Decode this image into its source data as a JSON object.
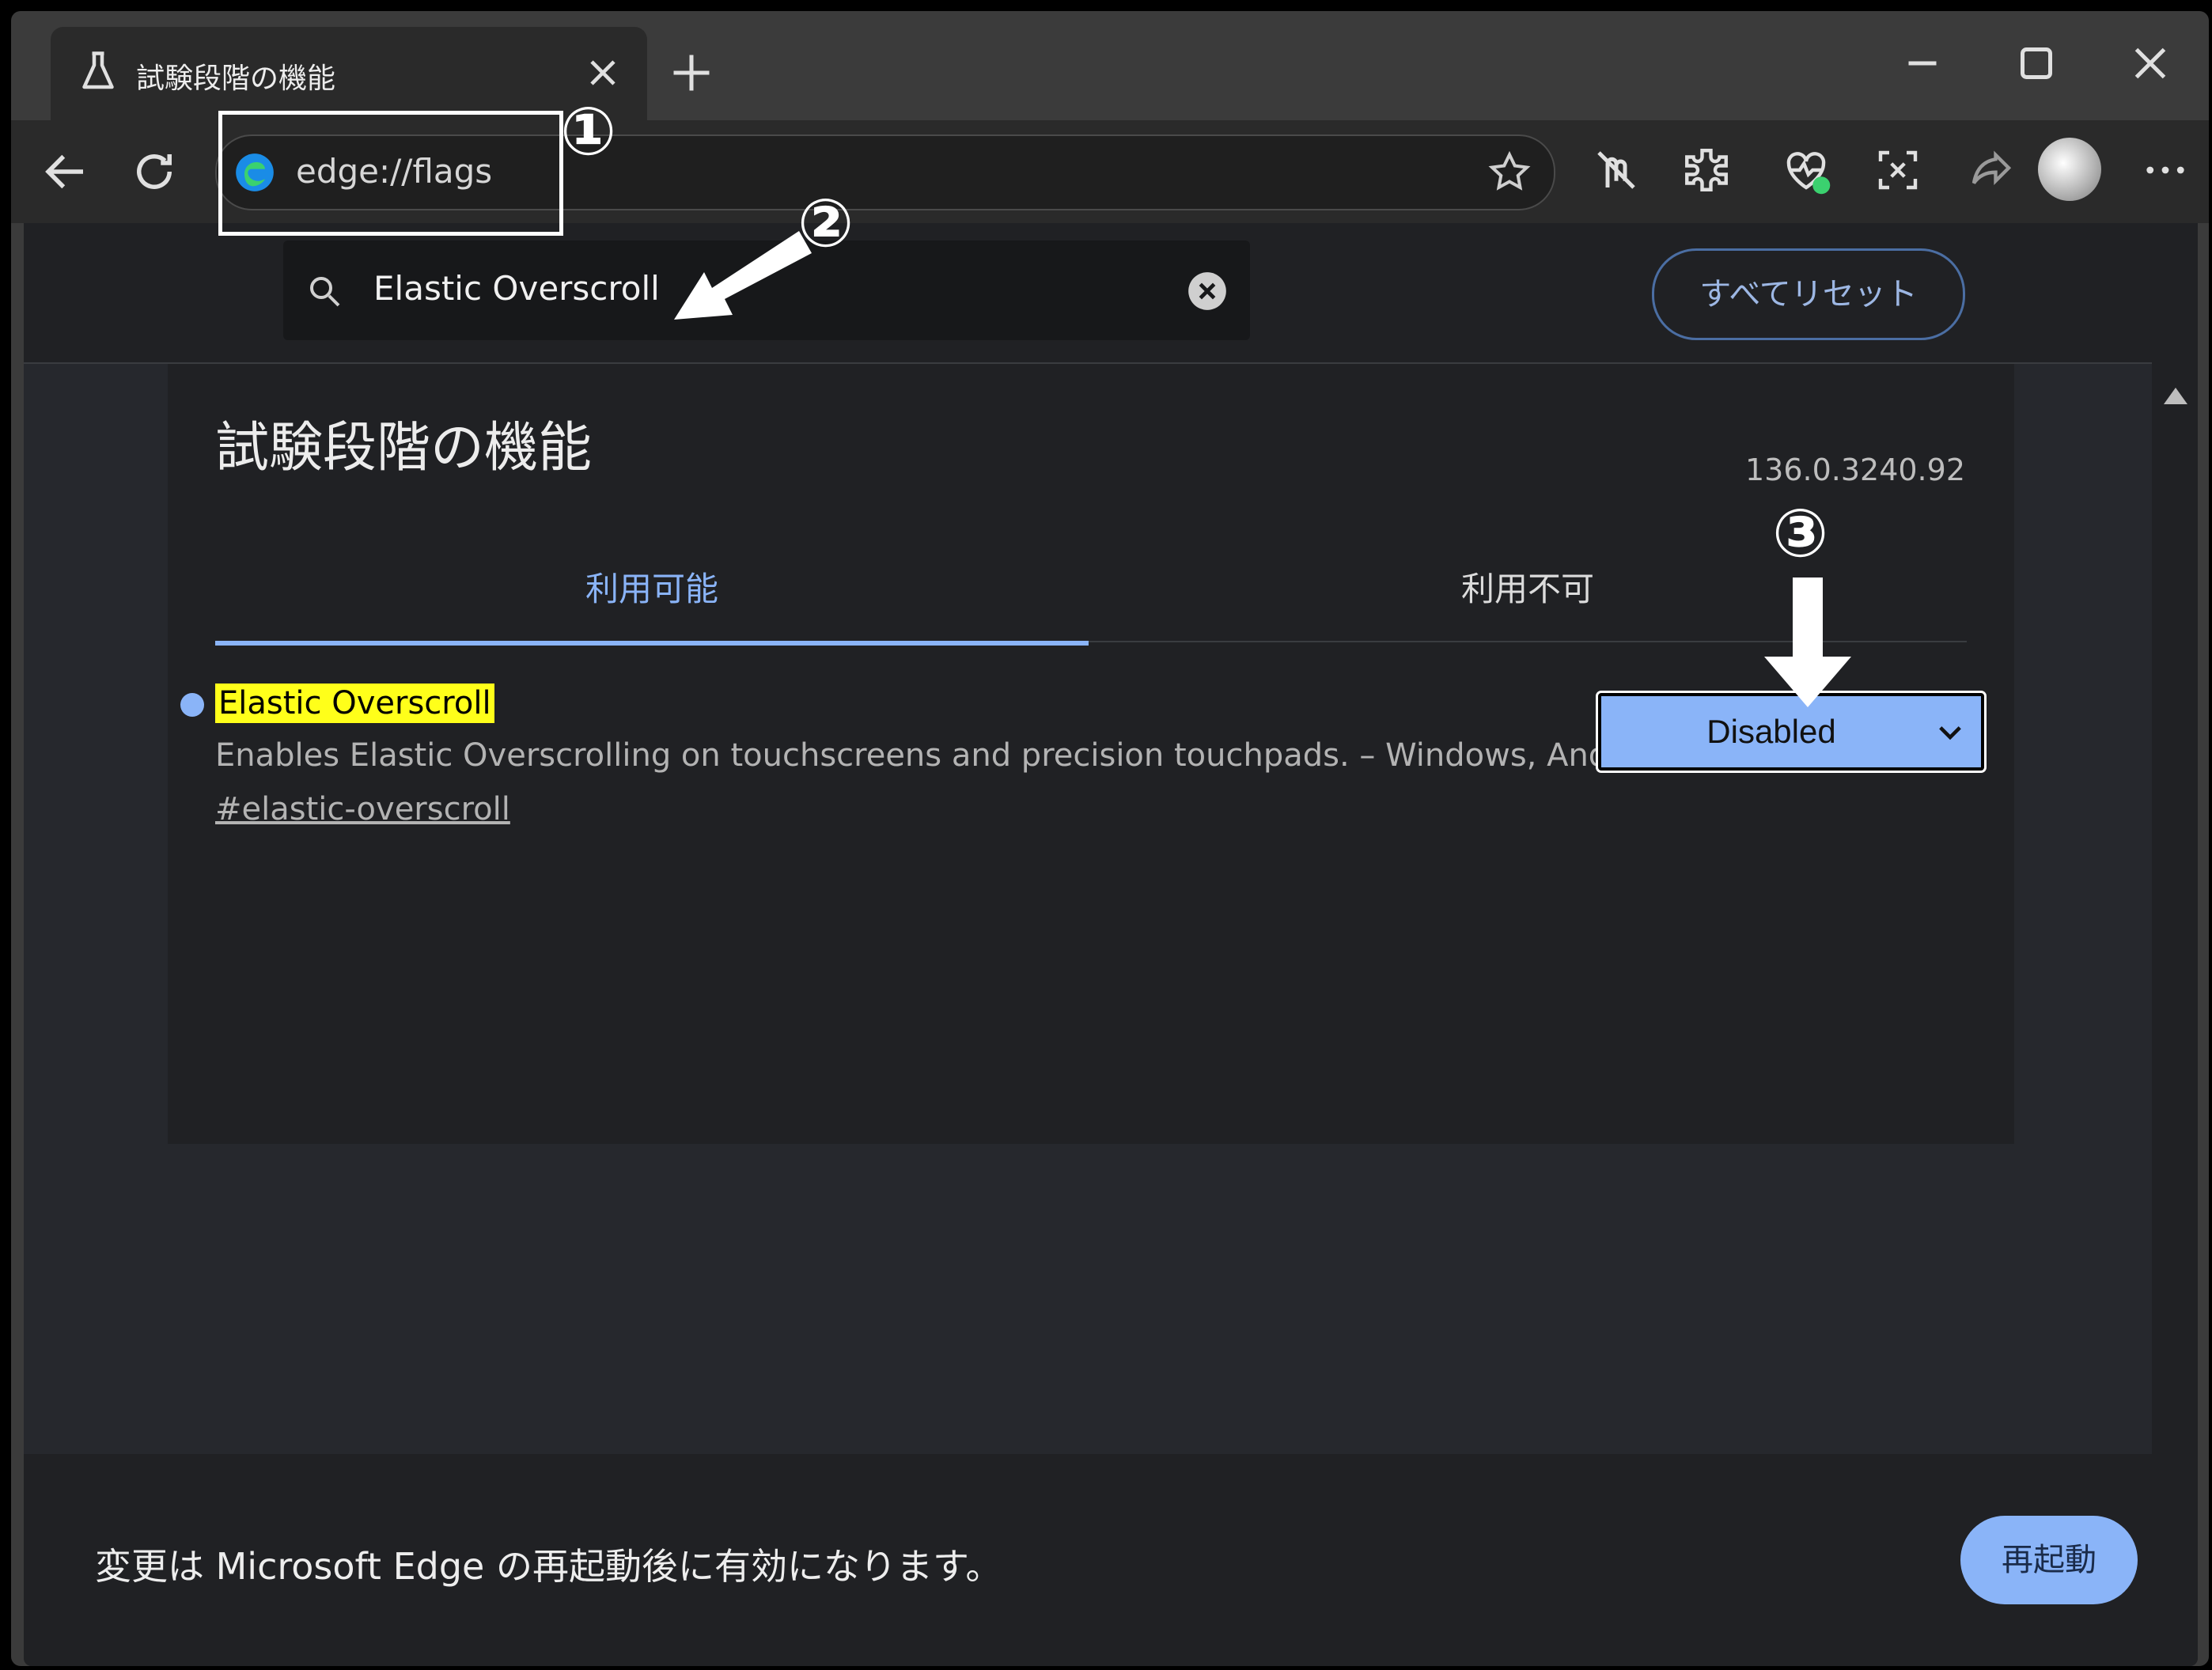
{
  "tab": {
    "title": "試験段階の機能",
    "close_label": "×"
  },
  "toolbar": {
    "url": "edge://flags"
  },
  "search": {
    "value": "Elastic Overscroll"
  },
  "header": {
    "reset_label": "すべてリセット"
  },
  "page": {
    "title": "試験段階の機能",
    "version": "136.0.3240.92",
    "tabs": [
      {
        "label": "利用可能",
        "active": true
      },
      {
        "label": "利用不可",
        "active": false
      }
    ]
  },
  "flag": {
    "name": "Elastic Overscroll",
    "description": "Enables Elastic Overscrolling on touchscreens and precision touchpads. – Windows, Android",
    "link": "#elastic-overscroll",
    "selected_option": "Disabled"
  },
  "footer": {
    "message": "変更は Microsoft Edge の再起動後に有効になります。",
    "restart_label": "再起動"
  },
  "annotations": {
    "one": "①",
    "two": "②",
    "three": "③"
  },
  "colors": {
    "accent": "#8ab4f8",
    "highlight": "#ffff1a",
    "background": "#26282d"
  },
  "icons": [
    "flask-icon",
    "close-icon",
    "plus-icon",
    "minimize-icon",
    "maximize-icon",
    "back-icon",
    "refresh-icon",
    "edge-logo-icon",
    "star-icon",
    "tracking-icon",
    "extensions-icon",
    "health-icon",
    "screenshot-icon",
    "share-icon",
    "more-icon",
    "search-icon",
    "clear-icon",
    "chevron-down-icon"
  ]
}
